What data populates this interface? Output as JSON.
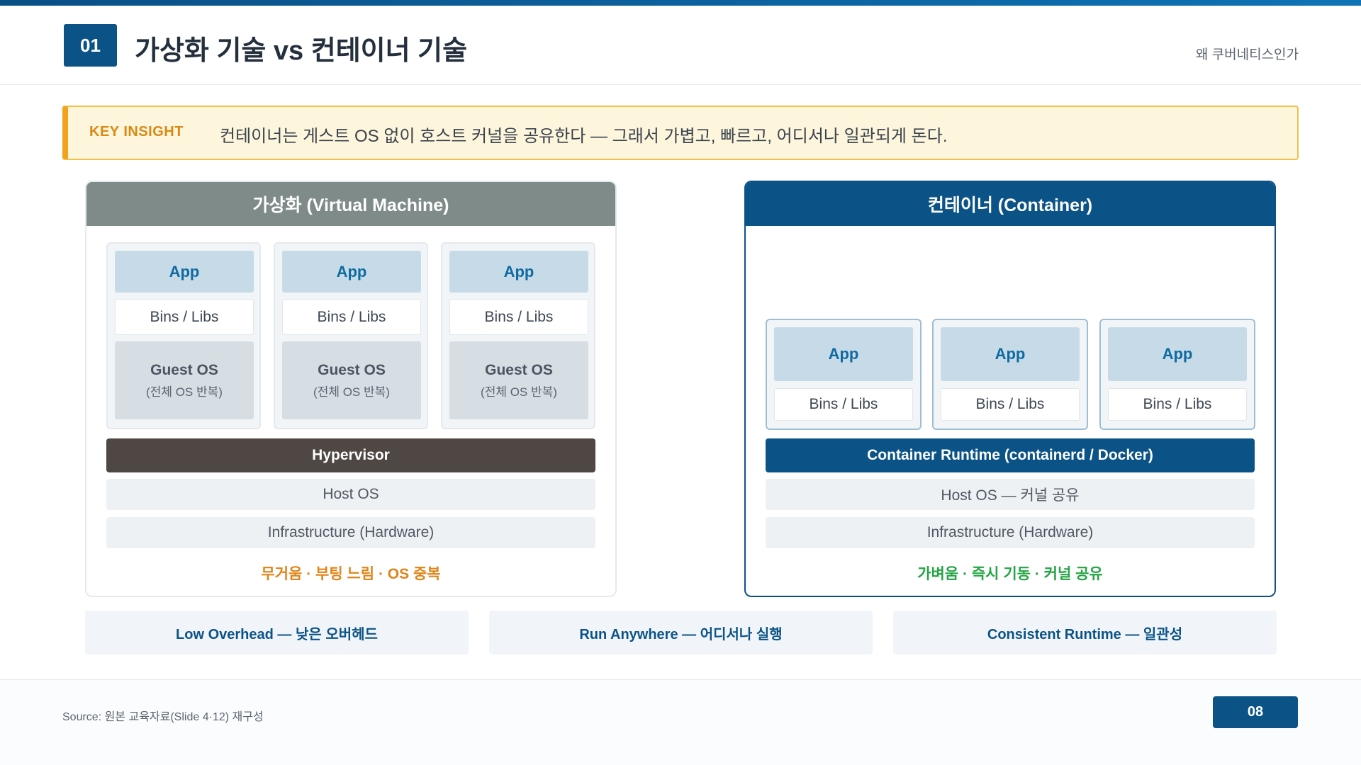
{
  "header": {
    "section_number": "01",
    "title": "가상화 기술 vs 컨테이너 기술",
    "topic": "왜 쿠버네티스인가"
  },
  "insight": {
    "label": "KEY INSIGHT",
    "text": "컨테이너는 게스트 OS 없이 호스트 커널을 공유한다 — 그래서 가볍고, 빠르고, 어디서나 일관되게 돈다."
  },
  "vm_panel": {
    "title": "가상화 (Virtual Machine)",
    "stacks": [
      {
        "app": "App",
        "bins": "Bins / Libs",
        "guest_os": "Guest OS",
        "guest_note": "(전체 OS 반복)"
      },
      {
        "app": "App",
        "bins": "Bins / Libs",
        "guest_os": "Guest OS",
        "guest_note": "(전체 OS 반복)"
      },
      {
        "app": "App",
        "bins": "Bins / Libs",
        "guest_os": "Guest OS",
        "guest_note": "(전체 OS 반복)"
      }
    ],
    "hypervisor": "Hypervisor",
    "host_os": "Host OS",
    "infrastructure": "Infrastructure (Hardware)",
    "summary": "무거움 · 부팅 느림 · OS 중복"
  },
  "container_panel": {
    "title": "컨테이너 (Container)",
    "stacks": [
      {
        "app": "App",
        "bins": "Bins / Libs"
      },
      {
        "app": "App",
        "bins": "Bins / Libs"
      },
      {
        "app": "App",
        "bins": "Bins / Libs"
      }
    ],
    "runtime": "Container Runtime (containerd / Docker)",
    "host_os": "Host OS — 커널 공유",
    "infrastructure": "Infrastructure (Hardware)",
    "summary": "가벼움 · 즉시 기동 · 커널 공유"
  },
  "benefits": [
    "Low Overhead — 낮은 오버헤드",
    "Run Anywhere — 어디서나 실행",
    "Consistent Runtime — 일관성"
  ],
  "footer": {
    "source": "Source: 원본 교육자료(Slide 4·12) 재구성",
    "page_number": "08"
  },
  "colors": {
    "brand_blue": "#0b5386",
    "vm_header": "#7e8b89",
    "hypervisor": "#4f4743",
    "insight_accent": "#f2a31b",
    "vm_summary": "#e08418",
    "container_summary": "#24a544"
  }
}
